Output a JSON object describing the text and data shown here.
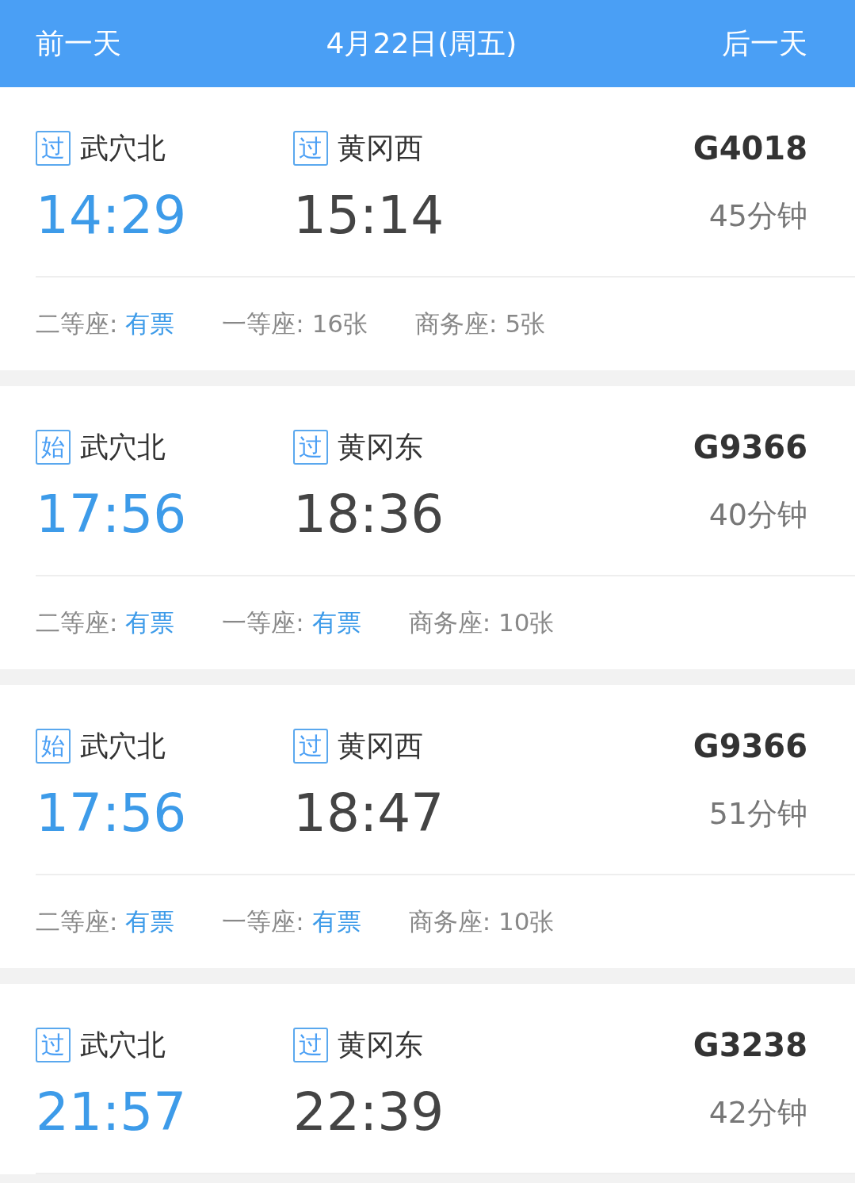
{
  "header": {
    "prev": "前一天",
    "date": "4月22日(周五)",
    "next": "后一天"
  },
  "trains": [
    {
      "from": {
        "badge": "过",
        "name": "武穴北",
        "time": "14:29"
      },
      "to": {
        "badge": "过",
        "name": "黄冈西",
        "time": "15:14"
      },
      "number": "G4018",
      "duration": "45分钟",
      "seats": [
        {
          "label": "二等座:",
          "value": "有票",
          "available": true
        },
        {
          "label": "一等座:",
          "value": "16张",
          "available": false
        },
        {
          "label": "商务座:",
          "value": "5张",
          "available": false
        }
      ]
    },
    {
      "from": {
        "badge": "始",
        "name": "武穴北",
        "time": "17:56"
      },
      "to": {
        "badge": "过",
        "name": "黄冈东",
        "time": "18:36"
      },
      "number": "G9366",
      "duration": "40分钟",
      "seats": [
        {
          "label": "二等座:",
          "value": "有票",
          "available": true
        },
        {
          "label": "一等座:",
          "value": "有票",
          "available": true
        },
        {
          "label": "商务座:",
          "value": "10张",
          "available": false
        }
      ]
    },
    {
      "from": {
        "badge": "始",
        "name": "武穴北",
        "time": "17:56"
      },
      "to": {
        "badge": "过",
        "name": "黄冈西",
        "time": "18:47"
      },
      "number": "G9366",
      "duration": "51分钟",
      "seats": [
        {
          "label": "二等座:",
          "value": "有票",
          "available": true
        },
        {
          "label": "一等座:",
          "value": "有票",
          "available": true
        },
        {
          "label": "商务座:",
          "value": "10张",
          "available": false
        }
      ]
    },
    {
      "from": {
        "badge": "过",
        "name": "武穴北",
        "time": "21:57"
      },
      "to": {
        "badge": "过",
        "name": "黄冈东",
        "time": "22:39"
      },
      "number": "G3238",
      "duration": "42分钟"
    }
  ]
}
